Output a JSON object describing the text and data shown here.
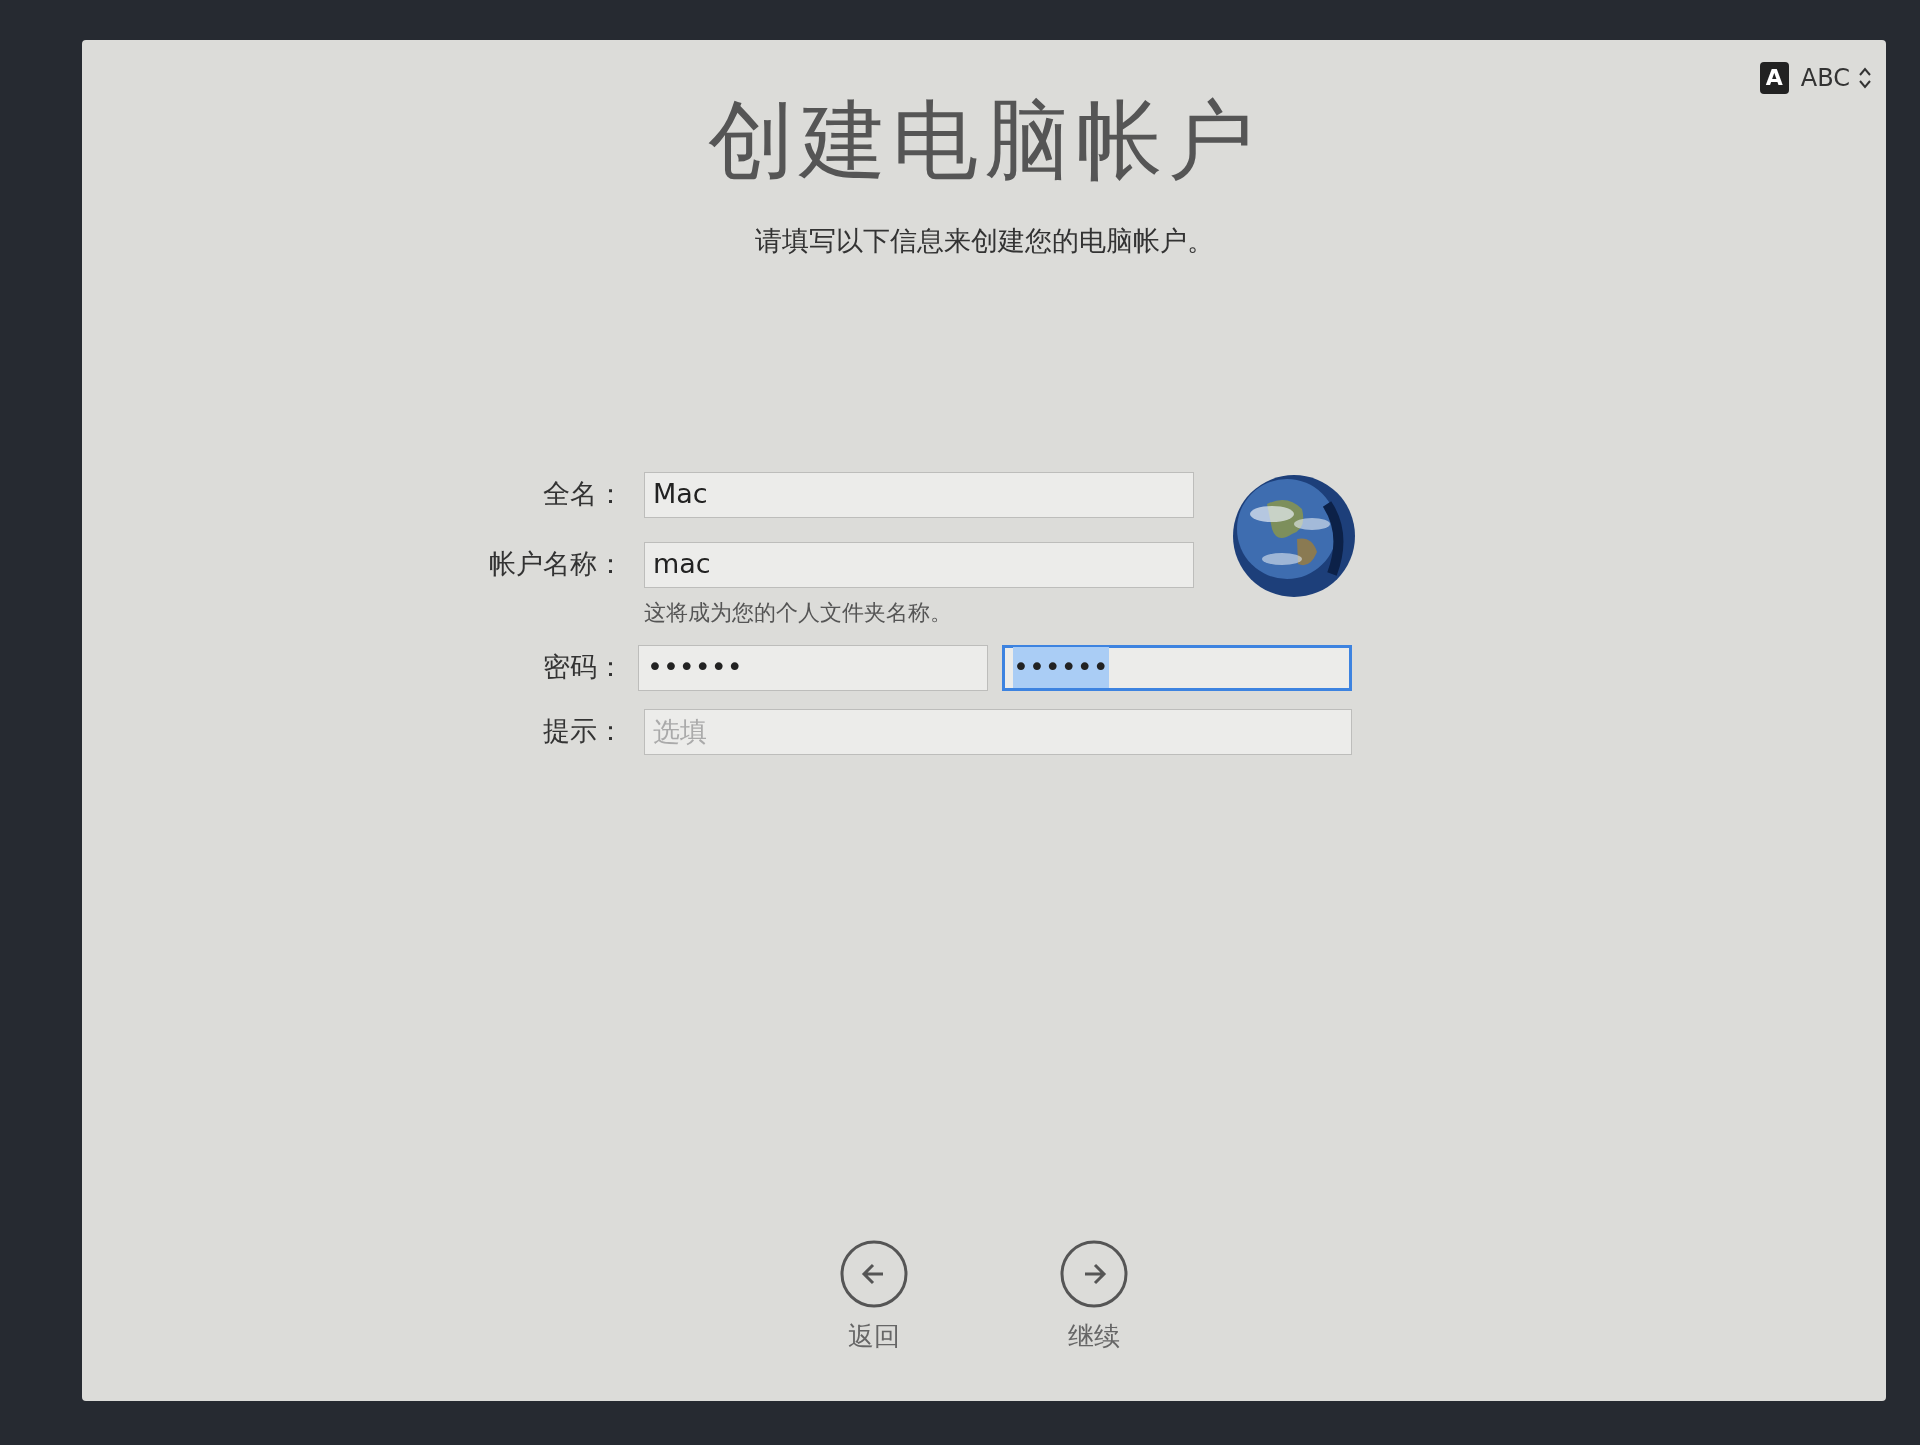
{
  "input_menu": {
    "badge": "A",
    "label": "ABC"
  },
  "title": "创建电脑帐户",
  "subtitle": "请填写以下信息来创建您的电脑帐户。",
  "form": {
    "full_name": {
      "label": "全名：",
      "value": "Mac"
    },
    "account_name": {
      "label": "帐户名称：",
      "value": "mac",
      "note": "这将成为您的个人文件夹名称。"
    },
    "password": {
      "label": "密码：",
      "value": "••••••",
      "verify_value": "••••••",
      "verify_focused": true
    },
    "hint": {
      "label": "提示：",
      "placeholder": "选填"
    }
  },
  "nav": [
    {
      "label": "返回",
      "kind": "back"
    },
    {
      "label": "继续",
      "kind": "forward"
    }
  ]
}
